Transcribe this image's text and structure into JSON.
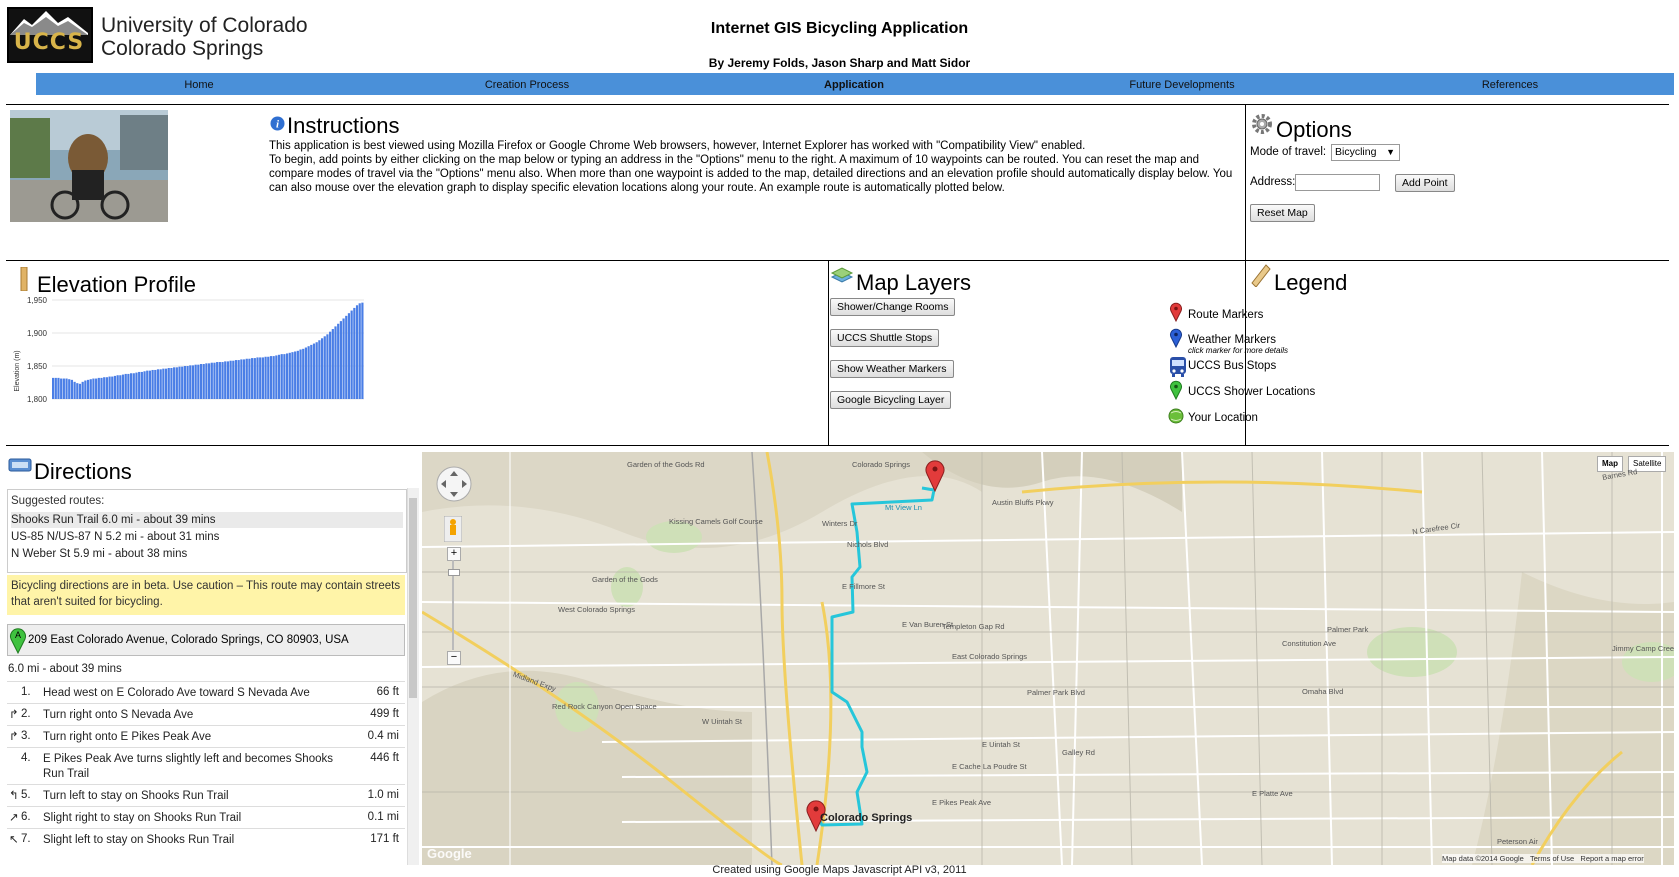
{
  "header": {
    "logo_text": "UCCS",
    "university_line1": "University of Colorado",
    "university_line2": "Colorado Springs",
    "title": "Internet GIS Bicycling Application",
    "byline": "By Jeremy Folds, Jason Sharp and Matt Sidor"
  },
  "nav": {
    "items": [
      "Home",
      "Creation Process",
      "Application",
      "Future Developments",
      "References"
    ],
    "active": "Application",
    "color": "#4a90d9"
  },
  "instructions": {
    "title": "Instructions",
    "line1": "This application is best viewed using Mozilla Firefox or Google Chrome Web browsers, however, Internet Explorer has worked with \"Compatibility View\" enabled.",
    "line2": "To begin, add points by either clicking on the map below or typing an address in the \"Options\" menu to the right. A maximum of 10 waypoints can be routed. You can reset the map and compare modes of travel via the \"Options\" menu also. When more than one waypoint is added to the map, detailed directions and an elevation profile should automatically display below. You can also mouse over the elevation graph to display specific elevation locations along your route. An example route is automatically plotted below."
  },
  "options": {
    "title": "Options",
    "mode_label": "Mode of travel:",
    "mode_value": "Bicycling",
    "address_label": "Address:",
    "address_value": "",
    "add_point": "Add Point",
    "reset_map": "Reset Map"
  },
  "elevation": {
    "title": "Elevation Profile",
    "y_axis_label": "Elevation (m)"
  },
  "chart_data": {
    "type": "area",
    "title": "",
    "ylabel": "Elevation (m)",
    "ylim": [
      1800,
      1950
    ],
    "yticks": [
      "1,950",
      "1,900",
      "1,850",
      "1,800"
    ],
    "values": [
      1832,
      1832,
      1832,
      1831,
      1831,
      1831,
      1830,
      1829,
      1826,
      1824,
      1823,
      1826,
      1828,
      1829,
      1830,
      1831,
      1831,
      1832,
      1832,
      1833,
      1833,
      1834,
      1834,
      1835,
      1836,
      1836,
      1837,
      1838,
      1838,
      1839,
      1839,
      1840,
      1841,
      1841,
      1842,
      1843,
      1843,
      1844,
      1844,
      1845,
      1845,
      1846,
      1846,
      1847,
      1847,
      1848,
      1848,
      1849,
      1849,
      1850,
      1850,
      1851,
      1851,
      1852,
      1852,
      1853,
      1853,
      1854,
      1854,
      1855,
      1855,
      1856,
      1856,
      1856,
      1857,
      1857,
      1858,
      1858,
      1859,
      1859,
      1860,
      1860,
      1861,
      1861,
      1862,
      1862,
      1863,
      1863,
      1863,
      1864,
      1864,
      1865,
      1865,
      1866,
      1867,
      1868,
      1868,
      1869,
      1870,
      1871,
      1872,
      1873,
      1875,
      1876,
      1878,
      1880,
      1882,
      1884,
      1886,
      1889,
      1892,
      1895,
      1898,
      1902,
      1906,
      1910,
      1914,
      1918,
      1922,
      1926,
      1930,
      1934,
      1938,
      1942,
      1945,
      1946
    ]
  },
  "map_layers": {
    "title": "Map Layers",
    "buttons": [
      "Shower/Change Rooms",
      "UCCS Shuttle Stops",
      "Show Weather Markers",
      "Google Bicycling Layer"
    ]
  },
  "legend": {
    "title": "Legend",
    "items": [
      {
        "label": "Route Markers",
        "icon": "red-marker-icon",
        "color": "#e23b3b"
      },
      {
        "label": "Weather Markers",
        "sub": "click marker for more details",
        "icon": "blue-marker-icon",
        "color": "#2b5fd6"
      },
      {
        "label": "UCCS Bus Stops",
        "icon": "bus-icon",
        "color": "#2a4fa8"
      },
      {
        "label": "UCCS Shower Locations",
        "icon": "green-marker-icon",
        "color": "#3fc23f"
      },
      {
        "label": "Your Location",
        "icon": "globe-icon",
        "color": "#6bbf3a"
      }
    ]
  },
  "directions": {
    "title": "Directions",
    "suggested_label": "Suggested routes:",
    "routes": [
      {
        "name": "Shooks Run Trail",
        "detail": "6.0 mi - about 39 mins"
      },
      {
        "name": "US-85 N/US-87 N",
        "detail": "5.2 mi - about 31 mins"
      },
      {
        "name": "N Weber St",
        "detail": "5.9 mi - about 38 mins"
      }
    ],
    "warning": "Bicycling directions are in beta. Use caution – This route may contain streets that aren't suited for bicycling.",
    "start_marker": "A",
    "start_address": "209 East Colorado Avenue, Colorado Springs, CO 80903, USA",
    "summary": "6.0 mi - about 39 mins",
    "steps": [
      {
        "num": "1.",
        "text": "Head west on E Colorado Ave toward S Nevada Ave",
        "dist": "66 ft",
        "icon": ""
      },
      {
        "num": "2.",
        "text": "Turn right onto S Nevada Ave",
        "dist": "499 ft",
        "icon": "↱"
      },
      {
        "num": "3.",
        "text": "Turn right onto E Pikes Peak Ave",
        "dist": "0.4 mi",
        "icon": "↱"
      },
      {
        "num": "4.",
        "text": "E Pikes Peak Ave turns slightly left and becomes Shooks Run Trail",
        "dist": "446 ft",
        "icon": ""
      },
      {
        "num": "5.",
        "text": "Turn left to stay on Shooks Run Trail",
        "dist": "1.0 mi",
        "icon": "↰"
      },
      {
        "num": "6.",
        "text": "Slight right to stay on Shooks Run Trail",
        "dist": "0.1 mi",
        "icon": "↗"
      },
      {
        "num": "7.",
        "text": "Slight left to stay on Shooks Run Trail",
        "dist": "171 ft",
        "icon": "↖"
      }
    ]
  },
  "map": {
    "type_buttons": [
      "Map",
      "Satellite"
    ],
    "attribution": "Map data ©2014 Google",
    "terms": "Terms of Use",
    "report": "Report a map error",
    "google_logo": "Google",
    "labels": [
      "Garden of the Gods Rd",
      "Colorado Springs",
      "Austin Bluffs Pkwy",
      "Kissing Camels Golf Course",
      "Garden of the Gods",
      "Winters Dr",
      "Nichols Blvd",
      "E Fillmore St",
      "West Colorado Springs",
      "E Van Buren St",
      "Templeton Gap Rd",
      "Palmer Park",
      "East Colorado Springs",
      "Palmer Park Blvd",
      "Constitution Ave",
      "Red Rock Canyon Open Space",
      "W Uintah St",
      "E Uintah St",
      "Galley Rd",
      "E Cache La Poudre St",
      "E Platte Ave",
      "E Pikes Peak Ave",
      "Colorado Springs",
      "Jimmy Camp Creek Park",
      "Barnes Rd",
      "N Carefree Cir",
      "Omaha Blvd",
      "Midland Expy",
      "Peterson Air",
      "Mt View Ln"
    ]
  },
  "footer": "Created using Google Maps Javascript API v3, 2011"
}
